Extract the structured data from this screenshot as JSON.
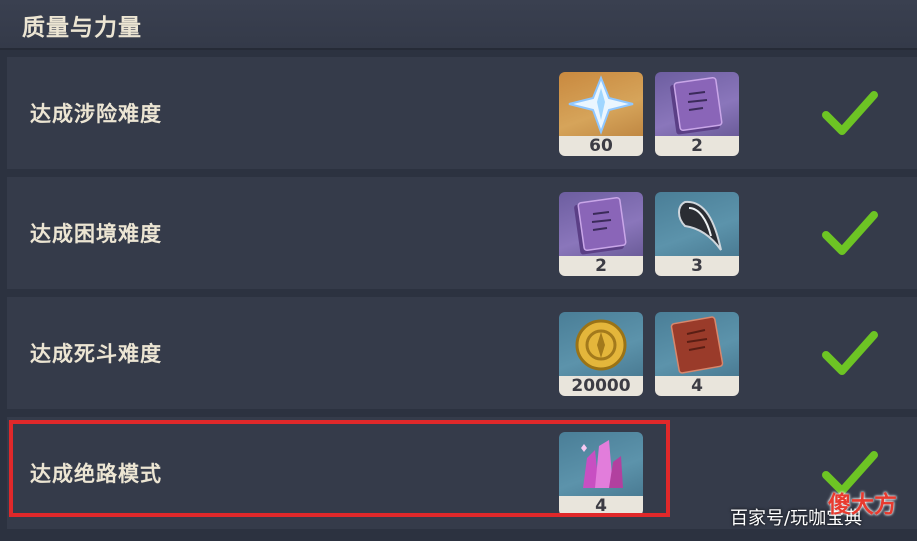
{
  "header": {
    "title": "质量与力量"
  },
  "rows": [
    {
      "label": "达成涉险难度",
      "completed": true,
      "rewards": [
        {
          "icon": "primogem-icon",
          "count": "60"
        },
        {
          "icon": "purple-book-icon",
          "count": "2"
        }
      ]
    },
    {
      "label": "达成困境难度",
      "completed": true,
      "rewards": [
        {
          "icon": "purple-book-icon",
          "count": "2"
        },
        {
          "icon": "horn-icon",
          "count": "3"
        }
      ]
    },
    {
      "label": "达成死斗难度",
      "completed": true,
      "rewards": [
        {
          "icon": "mora-coin-icon",
          "count": "20000"
        },
        {
          "icon": "red-book-icon",
          "count": "4"
        }
      ]
    },
    {
      "label": "达成绝路模式",
      "completed": true,
      "highlighted": true,
      "rewards": [
        {
          "icon": "crystal-icon",
          "count": "4"
        }
      ]
    }
  ],
  "watermark": {
    "text": "百家号/玩咖宝典",
    "logo": "傻大方"
  },
  "colors": {
    "check": "#6dc424",
    "highlight_border": "#e0282a",
    "label": "#ece5d3"
  }
}
